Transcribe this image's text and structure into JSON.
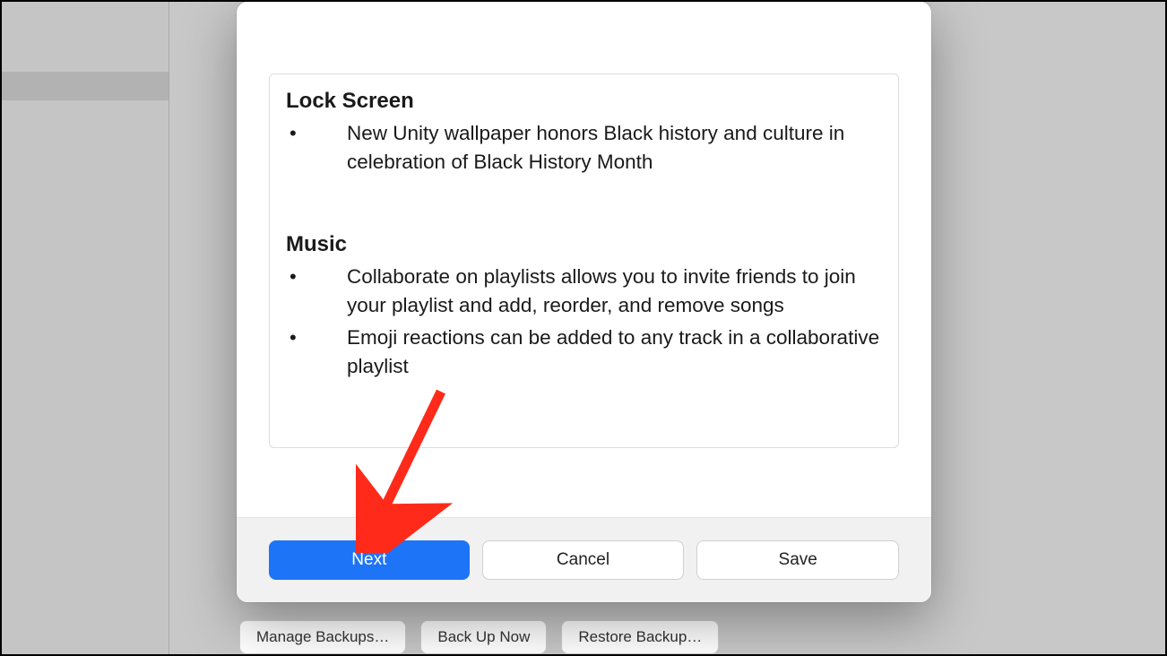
{
  "sections": [
    {
      "title": "Lock Screen",
      "items": [
        "New Unity wallpaper honors Black history and culture in celebration of Black History Month"
      ]
    },
    {
      "title": "Music",
      "items": [
        "Collaborate on playlists allows you to invite friends to join your playlist and add, reorder, and remove songs",
        "Emoji reactions can be added to any track in a collaborative playlist"
      ]
    }
  ],
  "buttons": {
    "next": "Next",
    "cancel": "Cancel",
    "save": "Save"
  },
  "backup": {
    "manage": "Manage Backups…",
    "now": "Back Up Now",
    "restore": "Restore Backup…"
  }
}
